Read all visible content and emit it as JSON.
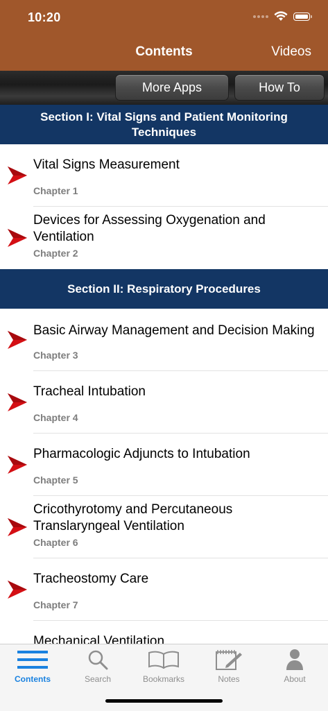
{
  "status": {
    "time": "10:20"
  },
  "nav": {
    "title": "Contents",
    "right_label": "Videos"
  },
  "toolbar": {
    "more_apps": "More Apps",
    "how_to": "How To"
  },
  "sections": [
    {
      "title": "Section I: Vital Signs and Patient Monitoring Techniques",
      "chapters": [
        {
          "title": "Vital Signs Measurement",
          "chapter": "Chapter 1"
        },
        {
          "title": "Devices for Assessing Oxygenation and Ventilation",
          "chapter": "Chapter 2"
        }
      ]
    },
    {
      "title": "Section II: Respiratory Procedures",
      "chapters": [
        {
          "title": "Basic Airway Management and Decision Making",
          "chapter": "Chapter 3"
        },
        {
          "title": "Tracheal Intubation",
          "chapter": "Chapter 4"
        },
        {
          "title": "Pharmacologic Adjuncts to Intubation",
          "chapter": "Chapter 5"
        },
        {
          "title": "Cricothyrotomy and Percutaneous Translaryngeal Ventilation",
          "chapter": "Chapter 6"
        },
        {
          "title": "Tracheostomy Care",
          "chapter": "Chapter 7"
        },
        {
          "title": "Mechanical Ventilation",
          "chapter": ""
        }
      ]
    }
  ],
  "tabs": [
    {
      "label": "Contents",
      "icon": "list-icon"
    },
    {
      "label": "Search",
      "icon": "search-icon"
    },
    {
      "label": "Bookmarks",
      "icon": "book-icon"
    },
    {
      "label": "Notes",
      "icon": "notepad-icon"
    },
    {
      "label": "About",
      "icon": "person-icon"
    }
  ],
  "colors": {
    "header_brown": "#a0572b",
    "section_blue": "#133664",
    "arrow_red": "#d40f14",
    "tab_active": "#1a82e0"
  }
}
